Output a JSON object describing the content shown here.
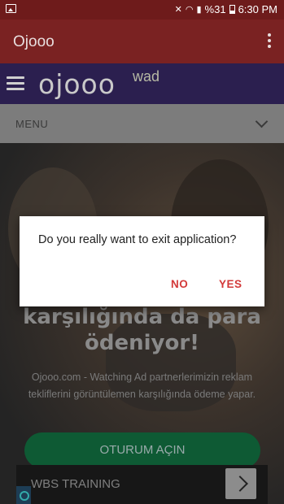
{
  "status_bar": {
    "battery": "%31",
    "time": "6:30 PM",
    "icons": [
      "image-icon",
      "mute-icon",
      "wifi-icon",
      "signal-icon",
      "battery-icon"
    ]
  },
  "app_bar": {
    "title": "Ojooo",
    "menu_icon": "overflow-menu-icon"
  },
  "site_header": {
    "logo": "ojooo",
    "logo_suffix": "wad",
    "menu_icon": "hamburger-icon"
  },
  "menu_bar": {
    "label": "MENU",
    "icon": "chevron-down-icon"
  },
  "hero": {
    "title_line1": "karşılığında da para",
    "title_line2": "ödeniyor!",
    "text": "Ojooo.com - Watching Ad partnerlerimizin reklam tekliflerini görüntülemen karşılığında ödeme yapar.",
    "button": "OTURUM AÇIN"
  },
  "ad": {
    "text": "WBS TRAINING"
  },
  "dialog": {
    "message": "Do you really want to exit application?",
    "no": "NO",
    "yes": "YES"
  }
}
